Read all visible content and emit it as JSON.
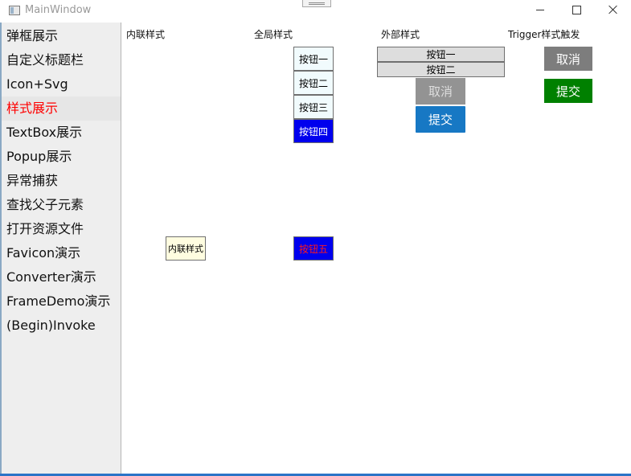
{
  "window": {
    "title": "MainWindow"
  },
  "sidebar": {
    "items": [
      {
        "label": "弹框展示"
      },
      {
        "label": "自定义标题栏"
      },
      {
        "label": "Icon+Svg"
      },
      {
        "label": "样式展示",
        "selected": true
      },
      {
        "label": "TextBox展示"
      },
      {
        "label": "Popup展示"
      },
      {
        "label": "异常捕获"
      },
      {
        "label": "查找父子元素"
      },
      {
        "label": "打开资源文件"
      },
      {
        "label": "Favicon演示"
      },
      {
        "label": "Converter演示"
      },
      {
        "label": "FrameDemo演示"
      },
      {
        "label": "(Begin)Invoke"
      }
    ]
  },
  "columns": {
    "inline": {
      "header": "内联样式",
      "button": "内联样式"
    },
    "global": {
      "header": "全局样式",
      "buttons": [
        "按钮一",
        "按钮二",
        "按钮三",
        "按钮四",
        "按钮五"
      ]
    },
    "external": {
      "header": "外部样式",
      "buttons": [
        "按钮一",
        "按钮二"
      ],
      "cancel": "取消",
      "submit": "提交"
    },
    "trigger": {
      "header": "Trigger样式触发",
      "cancel": "取消",
      "submit": "提交"
    }
  },
  "colors": {
    "selected_nav": "#ff0000",
    "highlight_blue": "#0000ee",
    "submit_blue": "#1778c4",
    "submit_green": "#008000"
  }
}
